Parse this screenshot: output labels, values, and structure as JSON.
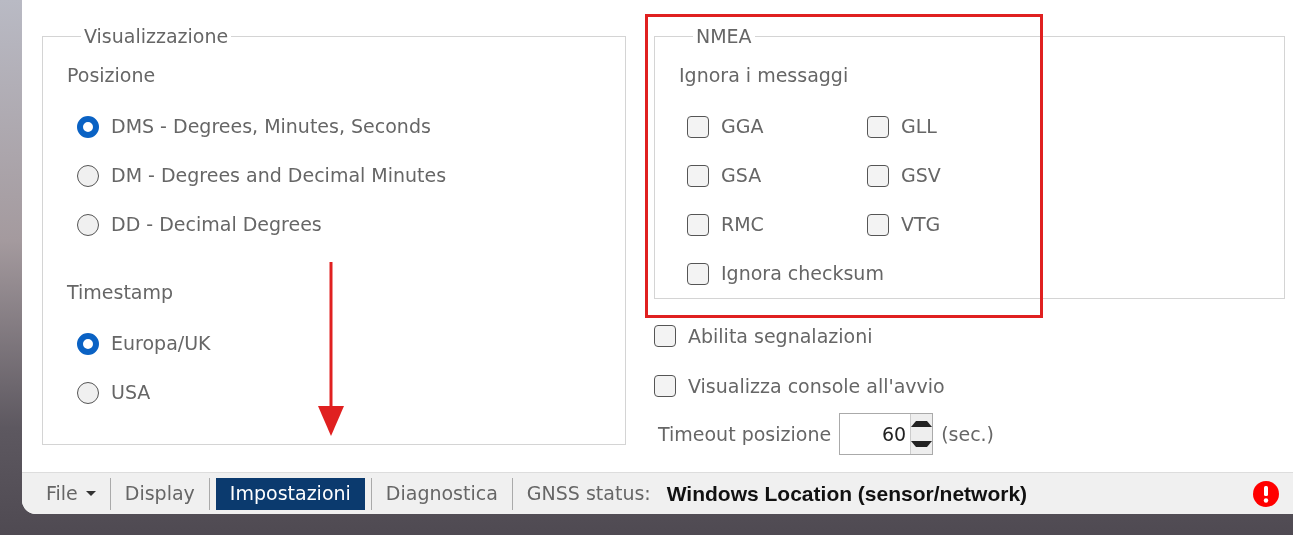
{
  "display_panel": {
    "legend": "Visualizzazione",
    "groups": [
      {
        "heading": "Posizione",
        "options": [
          {
            "label": "DMS - Degrees, Minutes, Seconds",
            "selected": true
          },
          {
            "label": "DM - Degrees and Decimal Minutes",
            "selected": false
          },
          {
            "label": "DD - Decimal Degrees",
            "selected": false
          }
        ]
      },
      {
        "heading": "Timestamp",
        "options": [
          {
            "label": "Europa/UK",
            "selected": true
          },
          {
            "label": "USA",
            "selected": false
          }
        ]
      }
    ]
  },
  "nmea_panel": {
    "legend": "NMEA",
    "heading": "Ignora i messaggi",
    "messages": [
      {
        "label": "GGA",
        "checked": false
      },
      {
        "label": "GLL",
        "checked": false
      },
      {
        "label": "GSA",
        "checked": false
      },
      {
        "label": "GSV",
        "checked": false
      },
      {
        "label": "RMC",
        "checked": false
      },
      {
        "label": "VTG",
        "checked": false
      }
    ],
    "checksum": {
      "label": "Ignora checksum",
      "checked": false
    }
  },
  "options": [
    {
      "label": "Abilita segnalazioni",
      "checked": false
    },
    {
      "label": "Visualizza console all'avvio",
      "checked": false
    }
  ],
  "timeout": {
    "label": "Timeout posizione",
    "value": "60",
    "unit": "(sec.)"
  },
  "tabs": [
    {
      "label": "File",
      "kind": "menu",
      "selected": false
    },
    {
      "label": "Display",
      "kind": "tab",
      "selected": false
    },
    {
      "label": "Impostazioni",
      "kind": "tab",
      "selected": true
    },
    {
      "label": "Diagnostica",
      "kind": "tab",
      "selected": false
    }
  ],
  "status": {
    "label": "GNSS status:",
    "value": "Windows Location (sensor/network)",
    "alert": true
  }
}
